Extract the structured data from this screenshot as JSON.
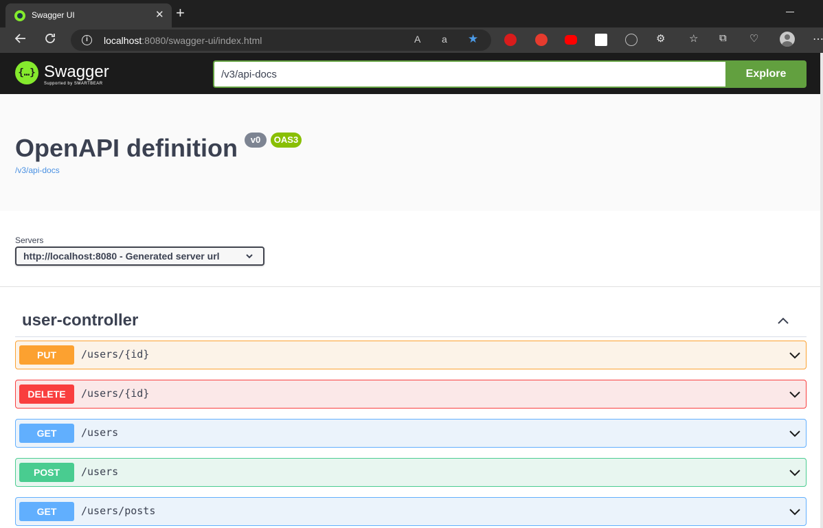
{
  "browser": {
    "tab_title": "Swagger UI",
    "tab_close": "✕",
    "new_tab": "+",
    "url_host": "localhost",
    "url_rest": ":8080/swagger-ui/index.html",
    "read_aloud": "A",
    "translate": "a",
    "icons": [
      "back-arrow-icon",
      "refresh-icon",
      "info-icon",
      "read-aloud-icon",
      "translate-icon",
      "favorite-star-icon",
      "extensions-icon",
      "favorites-icon",
      "collections-icon",
      "health-icon",
      "profile-icon",
      "more-icon"
    ]
  },
  "swagger": {
    "logo_text": "Swagger",
    "logo_subtext": "Supported by SMARTBEAR",
    "spec_url_value": "/v3/api-docs",
    "explore_label": "Explore"
  },
  "info": {
    "title": "OpenAPI definition",
    "version_badge": "v0",
    "oas_badge": "OAS3",
    "spec_link": "/v3/api-docs"
  },
  "servers": {
    "label": "Servers",
    "selected": "http://localhost:8080 - Generated server url"
  },
  "tag": {
    "name": "user-controller"
  },
  "operations": [
    {
      "method": "PUT",
      "path": "/users/{id}"
    },
    {
      "method": "DELETE",
      "path": "/users/{id}"
    },
    {
      "method": "GET",
      "path": "/users"
    },
    {
      "method": "POST",
      "path": "/users"
    },
    {
      "method": "GET",
      "path": "/users/posts"
    }
  ],
  "colors": {
    "put": "#fca130",
    "delete": "#f93e3e",
    "get": "#61affe",
    "post": "#49cc90",
    "explore": "#62a03f"
  }
}
